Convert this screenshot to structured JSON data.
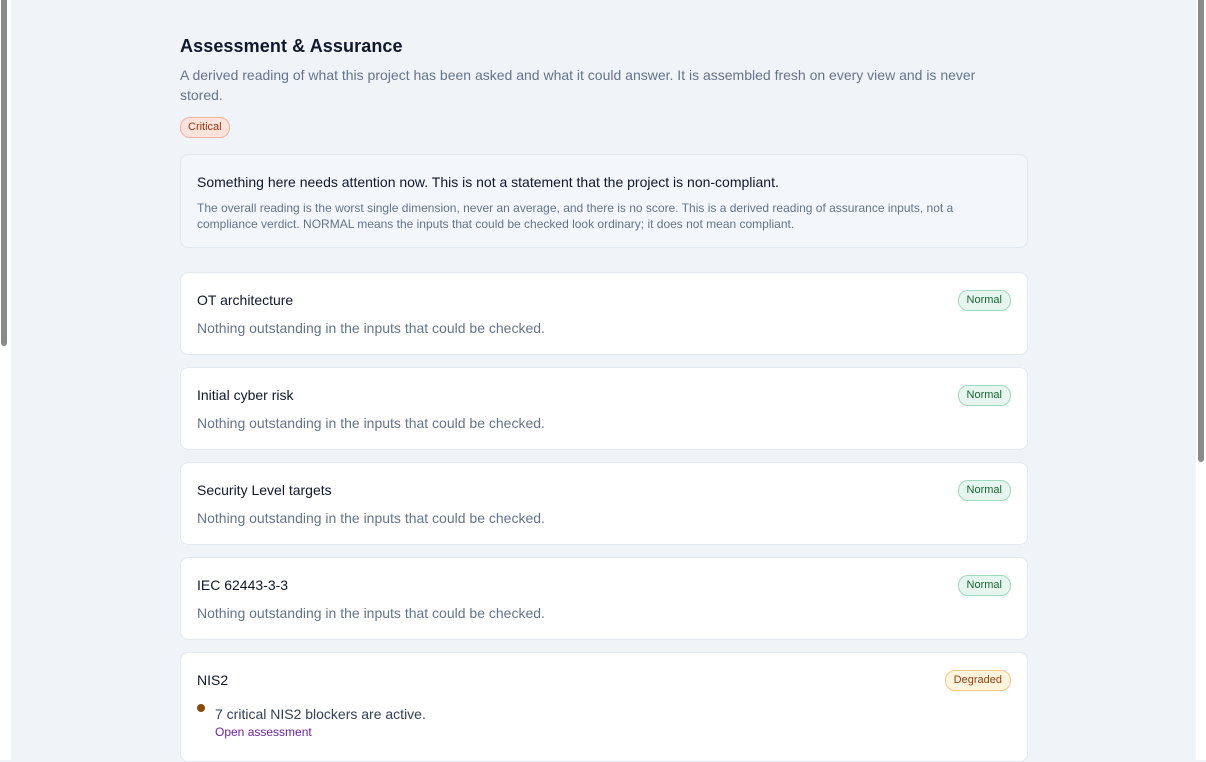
{
  "page": {
    "title": "Assessment & Assurance",
    "description": "A derived reading of what this project has been asked and what it could answer. It is assembled fresh on every view and is never stored.",
    "overall_status": "Critical"
  },
  "summary": {
    "headline": "Something here needs attention now. This is not a statement that the project is non-compliant.",
    "note": "The overall reading is the worst single dimension, never an average, and there is no score. This is a derived reading of assurance inputs, not a compliance verdict. NORMAL means the inputs that could be checked look ordinary; it does not mean compliant."
  },
  "dimensions": [
    {
      "name": "OT architecture",
      "status": "Normal",
      "message": "Nothing outstanding in the inputs that could be checked."
    },
    {
      "name": "Initial cyber risk",
      "status": "Normal",
      "message": "Nothing outstanding in the inputs that could be checked."
    },
    {
      "name": "Security Level targets",
      "status": "Normal",
      "message": "Nothing outstanding in the inputs that could be checked."
    },
    {
      "name": "IEC 62443-3-3",
      "status": "Normal",
      "message": "Nothing outstanding in the inputs that could be checked."
    },
    {
      "name": "NIS2",
      "status": "Degraded",
      "finding": "7 critical NIS2 blockers are active.",
      "link_label": "Open assessment"
    }
  ],
  "colors": {
    "critical": "#9a3412",
    "normal": "#166534",
    "degraded": "#92400e",
    "link": "#6b21a8"
  }
}
